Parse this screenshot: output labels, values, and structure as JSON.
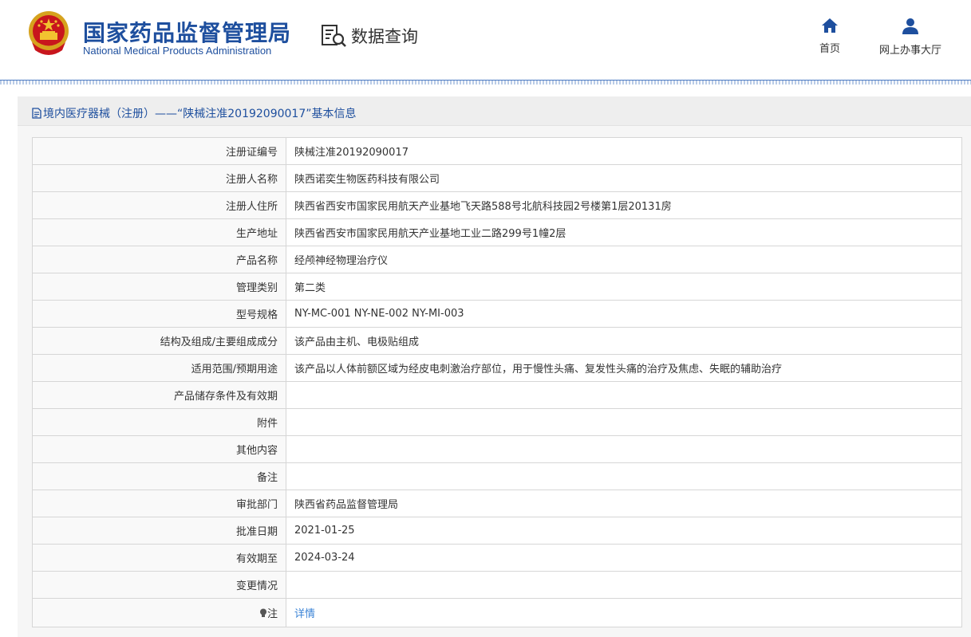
{
  "header": {
    "brand_cn": "国家药品监督管理局",
    "brand_en": "National Medical Products Administration",
    "query_label": "数据查询",
    "nav": {
      "home": "首页",
      "hall": "网上办事大厅"
    }
  },
  "colors": {
    "brand_blue": "#1e4f9e",
    "link_blue": "#3a83d6"
  },
  "panel": {
    "title": "境内医疗器械（注册）——“陕械注准20192090017”基本信息"
  },
  "rows": [
    {
      "label": "注册证编号",
      "value": "陕械注准20192090017"
    },
    {
      "label": "注册人名称",
      "value": "陕西诺奕生物医药科技有限公司"
    },
    {
      "label": "注册人住所",
      "value": "陕西省西安市国家民用航天产业基地飞天路588号北航科技园2号楼第1层20131房"
    },
    {
      "label": "生产地址",
      "value": "陕西省西安市国家民用航天产业基地工业二路299号1幢2层"
    },
    {
      "label": "产品名称",
      "value": "经颅神经物理治疗仪"
    },
    {
      "label": "管理类别",
      "value": "第二类"
    },
    {
      "label": "型号规格",
      "value": "NY-MC-001 NY-NE-002 NY-MI-003"
    },
    {
      "label": "结构及组成/主要组成成分",
      "value": "该产品由主机、电极贴组成"
    },
    {
      "label": "适用范围/预期用途",
      "value": "该产品以人体前额区域为经皮电刺激治疗部位，用于慢性头痛、复发性头痛的治疗及焦虑、失眠的辅助治疗"
    },
    {
      "label": "产品储存条件及有效期",
      "value": ""
    },
    {
      "label": "附件",
      "value": ""
    },
    {
      "label": "其他内容",
      "value": ""
    },
    {
      "label": "备注",
      "value": ""
    },
    {
      "label": "审批部门",
      "value": "陕西省药品监督管理局"
    },
    {
      "label": "批准日期",
      "value": "2021-01-25"
    },
    {
      "label": "有效期至",
      "value": "2024-03-24"
    },
    {
      "label": "变更情况",
      "value": ""
    }
  ],
  "note": {
    "label": "注",
    "link": "详情"
  }
}
